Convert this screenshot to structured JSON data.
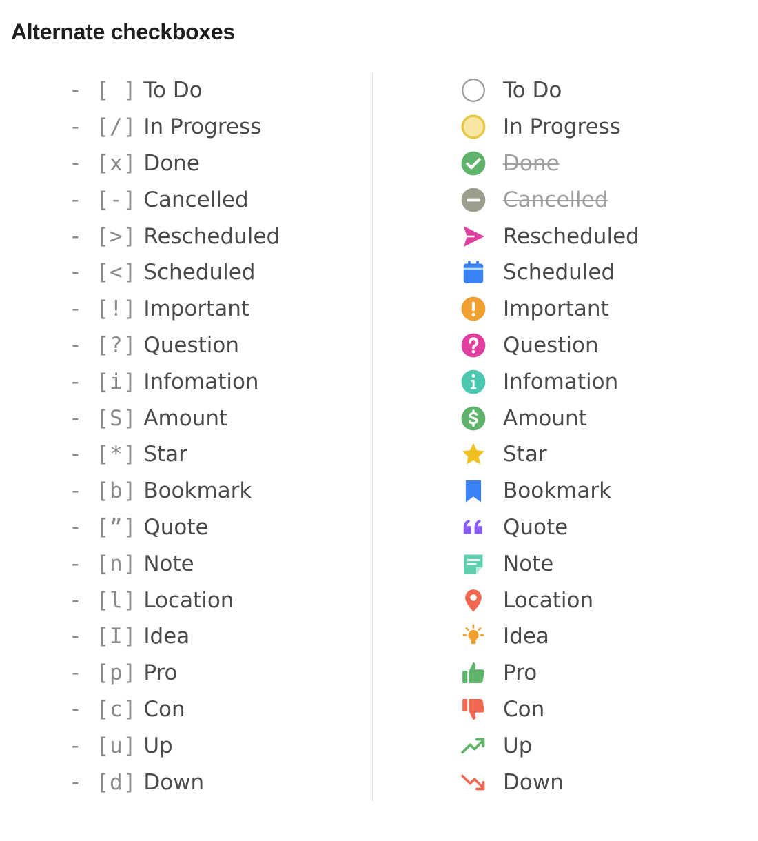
{
  "heading": "Alternate checkboxes",
  "left_items": [
    {
      "mark": "- [ ]",
      "label": "To Do"
    },
    {
      "mark": "- [/]",
      "label": "In Progress"
    },
    {
      "mark": "- [x]",
      "label": "Done"
    },
    {
      "mark": "- [-]",
      "label": "Cancelled"
    },
    {
      "mark": "- [>]",
      "label": "Rescheduled"
    },
    {
      "mark": "- [<]",
      "label": "Scheduled"
    },
    {
      "mark": "- [!]",
      "label": "Important"
    },
    {
      "mark": "- [?]",
      "label": "Question"
    },
    {
      "mark": "- [i]",
      "label": "Infomation"
    },
    {
      "mark": "- [S]",
      "label": "Amount"
    },
    {
      "mark": "- [*]",
      "label": "Star"
    },
    {
      "mark": "- [b]",
      "label": "Bookmark"
    },
    {
      "mark": "- [”]",
      "label": "Quote"
    },
    {
      "mark": "- [n]",
      "label": "Note"
    },
    {
      "mark": "- [l]",
      "label": "Location"
    },
    {
      "mark": "- [I]",
      "label": "Idea"
    },
    {
      "mark": "- [p]",
      "label": "Pro"
    },
    {
      "mark": "- [c]",
      "label": "Con"
    },
    {
      "mark": "- [u]",
      "label": "Up"
    },
    {
      "mark": "- [d]",
      "label": "Down"
    }
  ],
  "right_items": [
    {
      "icon": "circle-empty-icon",
      "label": "To Do",
      "color": "#9a9a9a"
    },
    {
      "icon": "circle-yellow-icon",
      "label": "In Progress",
      "color": "#e8c84a"
    },
    {
      "icon": "check-circle-icon",
      "label": "Done",
      "color": "#5fb36a",
      "struck": true
    },
    {
      "icon": "minus-circle-icon",
      "label": "Cancelled",
      "color": "#9e9e8e",
      "struck": true
    },
    {
      "icon": "send-arrow-icon",
      "label": "Rescheduled",
      "color": "#e040a0"
    },
    {
      "icon": "calendar-icon",
      "label": "Scheduled",
      "color": "#3b82f6"
    },
    {
      "icon": "exclamation-circle-icon",
      "label": "Important",
      "color": "#f0a030"
    },
    {
      "icon": "question-circle-icon",
      "label": "Question",
      "color": "#e040a0"
    },
    {
      "icon": "info-circle-icon",
      "label": "Infomation",
      "color": "#4cc8b0"
    },
    {
      "icon": "dollar-circle-icon",
      "label": "Amount",
      "color": "#5fb36a"
    },
    {
      "icon": "star-icon",
      "label": "Star",
      "color": "#f0c020"
    },
    {
      "icon": "bookmark-icon",
      "label": "Bookmark",
      "color": "#3b82f6"
    },
    {
      "icon": "quote-icon",
      "label": "Quote",
      "color": "#8b5cf6"
    },
    {
      "icon": "note-icon",
      "label": "Note",
      "color": "#5ed0b0"
    },
    {
      "icon": "location-pin-icon",
      "label": "Location",
      "color": "#f06850"
    },
    {
      "icon": "lightbulb-icon",
      "label": "Idea",
      "color": "#f0a030"
    },
    {
      "icon": "thumbs-up-icon",
      "label": "Pro",
      "color": "#5fb36a"
    },
    {
      "icon": "thumbs-down-icon",
      "label": "Con",
      "color": "#f06850"
    },
    {
      "icon": "trend-up-icon",
      "label": "Up",
      "color": "#5fb36a"
    },
    {
      "icon": "trend-down-icon",
      "label": "Down",
      "color": "#f06850"
    }
  ]
}
